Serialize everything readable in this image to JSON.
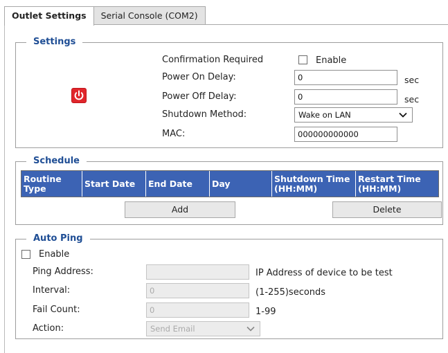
{
  "tabs": [
    {
      "label": "Outlet Settings",
      "active": true
    },
    {
      "label": "Serial Console (COM2)",
      "active": false
    }
  ],
  "settings": {
    "legend": "Settings",
    "power_icon": "power-icon",
    "confirmation_label": "Confirmation Required",
    "confirmation_checkbox_label": "Enable",
    "confirmation_checked": false,
    "power_on_delay_label": "Power On Delay:",
    "power_on_delay_value": "0",
    "power_on_delay_unit": "sec",
    "power_off_delay_label": "Power Off Delay:",
    "power_off_delay_value": "0",
    "power_off_delay_unit": "sec",
    "shutdown_method_label": "Shutdown Method:",
    "shutdown_method_value": "Wake on LAN",
    "mac_label": "MAC:",
    "mac_value": "000000000000"
  },
  "schedule": {
    "legend": "Schedule",
    "columns": [
      "Routine Type",
      "Start Date",
      "End Date",
      "Day",
      "Shutdown Time (HH:MM)",
      "Restart Time (HH:MM)"
    ],
    "add_label": "Add",
    "delete_label": "Delete"
  },
  "auto_ping": {
    "legend": "Auto Ping",
    "enable_label": "Enable",
    "enable_checked": false,
    "ping_address_label": "Ping Address:",
    "ping_address_value": "",
    "ping_address_hint": "IP Address of device to be test",
    "interval_label": "Interval:",
    "interval_value": "0",
    "interval_hint": "(1-255)seconds",
    "fail_count_label": "Fail Count:",
    "fail_count_value": "0",
    "fail_count_hint": "1-99",
    "action_label": "Action:",
    "action_value": "Send Email"
  },
  "colors": {
    "legend_text": "#1f4e95",
    "table_header": "#3c63b4",
    "power_button": "#e0262b"
  }
}
